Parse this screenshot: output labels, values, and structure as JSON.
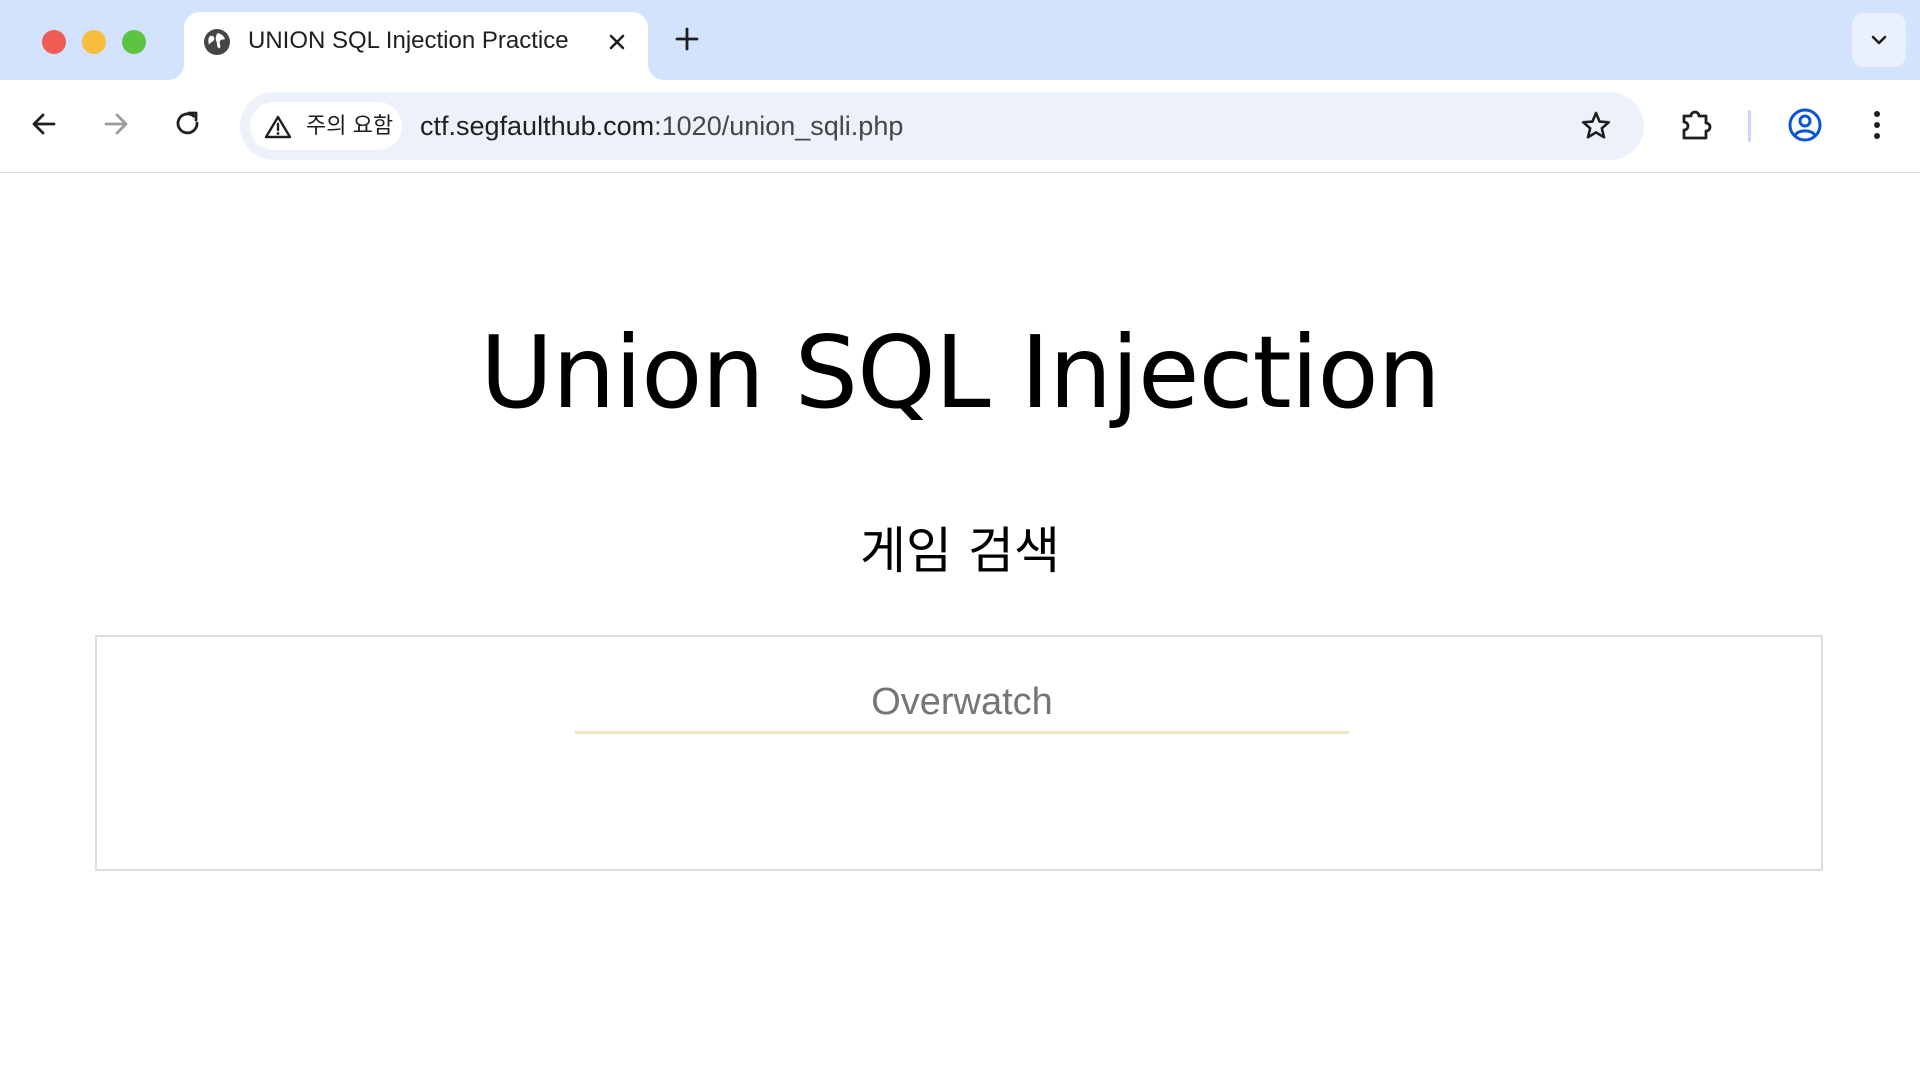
{
  "browser": {
    "tab": {
      "title": "UNION SQL Injection Practice",
      "favicon": "globe-icon"
    },
    "security_chip": {
      "label": "주의 요함",
      "icon": "warning-triangle-icon"
    },
    "address": {
      "host": "ctf.segfaulthub.com",
      "path": ":1020/union_sqli.php"
    },
    "colors": {
      "tabstrip": "#d3e3fd",
      "omnibox": "#edf2fa",
      "profile_accent": "#0b57d0",
      "close_light": "#ee5c54",
      "minimize_light": "#f6be3b",
      "maximize_light": "#5dc443"
    }
  },
  "page": {
    "title": "Union SQL Injection",
    "section_heading": "게임 검색",
    "search": {
      "placeholder": "Overwatch",
      "value": "",
      "underline_color": "#efe5c2"
    }
  }
}
